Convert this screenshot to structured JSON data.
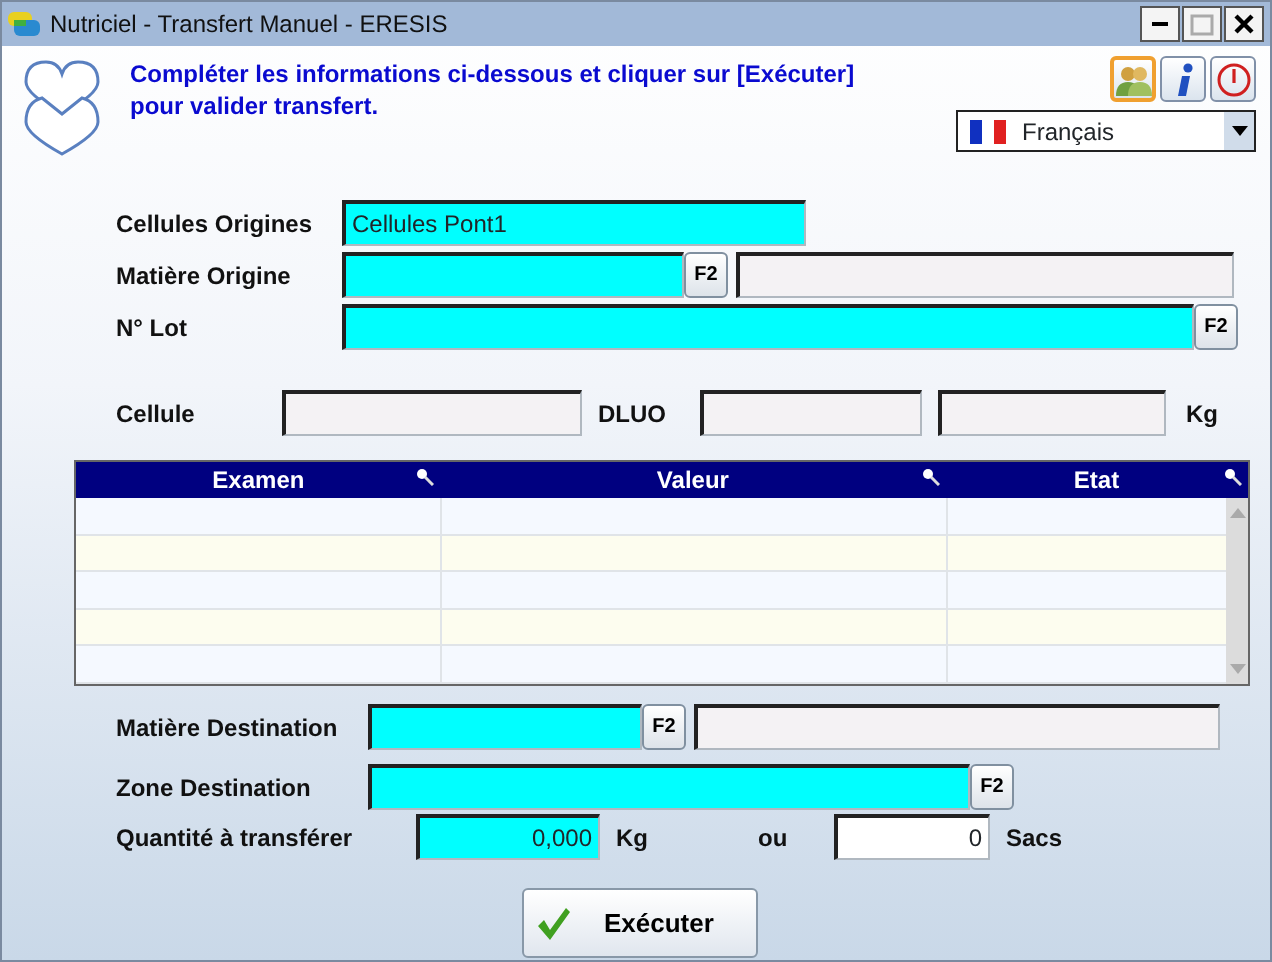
{
  "window": {
    "title": "Nutriciel - Transfert Manuel - ERESIS"
  },
  "instructions": "Compléter les informations ci-dessous et cliquer sur [Exécuter] pour valider transfert.",
  "language": {
    "value": "Français"
  },
  "origin_fields": [
    {
      "kind": "text",
      "label": "Cellules Origines",
      "value": "Cellules Pont1"
    },
    {
      "kind": "lookup",
      "label": "Matière Origine",
      "key": "F2",
      "with_description": true
    },
    {
      "kind": "lookup",
      "label": "N° Lot",
      "key": "F2",
      "with_description": false
    }
  ],
  "stock": {
    "cellule_label": "Cellule",
    "dluo_label": "DLUO",
    "unit": "Kg"
  },
  "table": {
    "columns": [
      "Examen",
      "Valeur",
      "Etat"
    ]
  },
  "destination_fields": [
    {
      "kind": "lookup",
      "label": "Matière Destination",
      "key": "F2",
      "with_description": true
    },
    {
      "kind": "lookup",
      "label": "Zone Destination",
      "key": "F2",
      "with_description": false
    }
  ],
  "quantity": {
    "label": "Quantité à transférer",
    "kg_value": "0,000",
    "kg_unit": "Kg",
    "or": "ou",
    "sacs_value": "0",
    "sacs_unit": "Sacs"
  },
  "execute_button": {
    "label": "Exécuter"
  }
}
